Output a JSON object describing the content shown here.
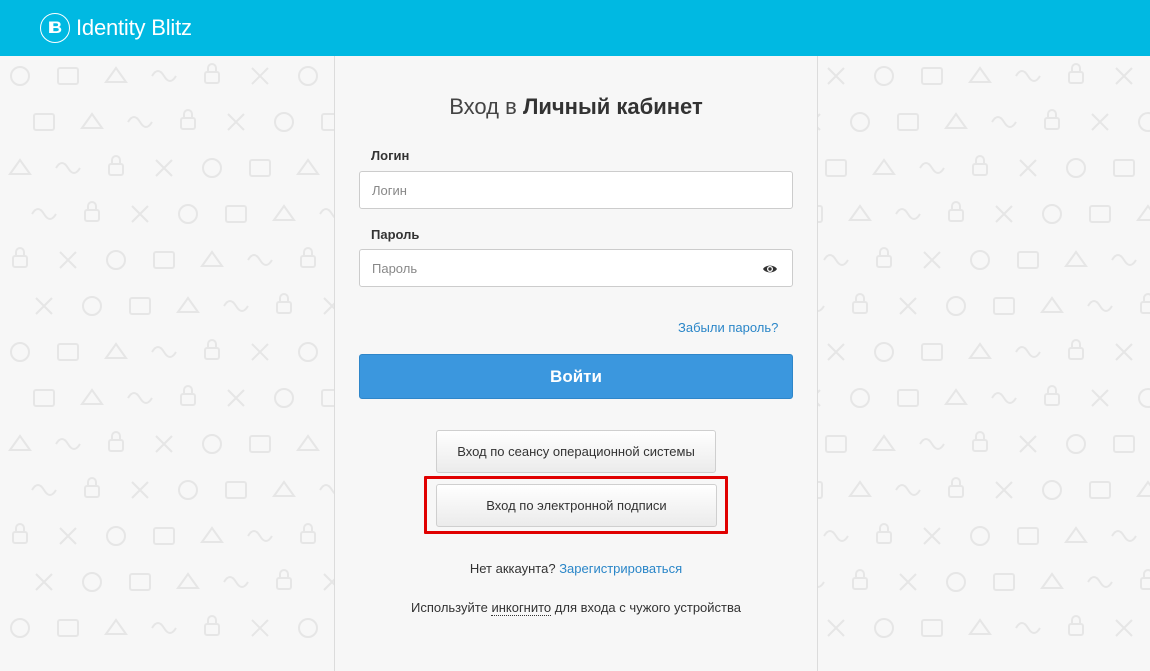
{
  "header": {
    "logo_mark": "IB",
    "logo_text": "Identity Blitz"
  },
  "login": {
    "title_prefix": "Вход в",
    "title_bold": "Личный кабинет",
    "login_label": "Логин",
    "login_placeholder": "Логин",
    "password_label": "Пароль",
    "password_placeholder": "Пароль",
    "forgot_link": "Забыли пароль?",
    "submit_label": "Войти",
    "os_session_button": "Вход по сеансу операционной системы",
    "signature_button": "Вход по электронной подписи",
    "no_account_text": "Нет аккаунта?",
    "register_link": "Зарегистрироваться",
    "incognito_prefix": "Используйте",
    "incognito_link": "инкогнито",
    "incognito_suffix": "для входа с чужого устройства"
  },
  "colors": {
    "header": "#00b9e2",
    "primary_button": "#3b97de",
    "link": "#2a86c8",
    "highlight": "#e00000"
  },
  "icons": [
    "eye-icon",
    "logo-icon"
  ]
}
